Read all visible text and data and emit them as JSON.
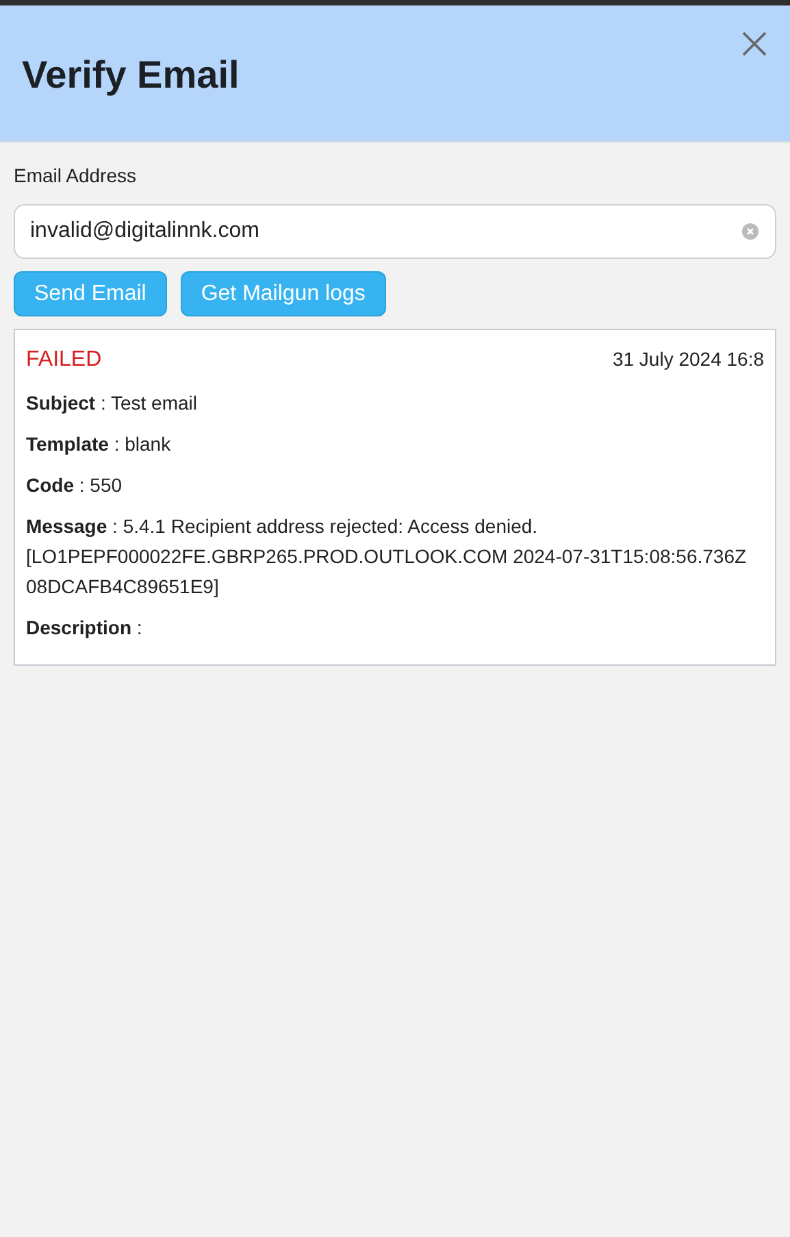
{
  "dialog": {
    "title": "Verify Email"
  },
  "email_field": {
    "label": "Email Address",
    "value": "invalid@digitalinnk.com"
  },
  "buttons": [
    "Send Email",
    "Get Mailgun logs"
  ],
  "result": {
    "status": {
      "text": "FAILED",
      "kind": "failed"
    },
    "time": "31 July 2024 16:8",
    "fields": [
      "**Subject** : Test email",
      "**Template** : blank",
      "**Code** : 550",
      "**Message** : 5.4.1 Recipient address rejected: Access denied. [LO1PEPF000022FE.GBRP265.PROD.OUTLOOK.COM 2024-07-31T15:08:56.736Z 08DCAFB4C89651E9]",
      "**Description** :"
    ]
  }
}
